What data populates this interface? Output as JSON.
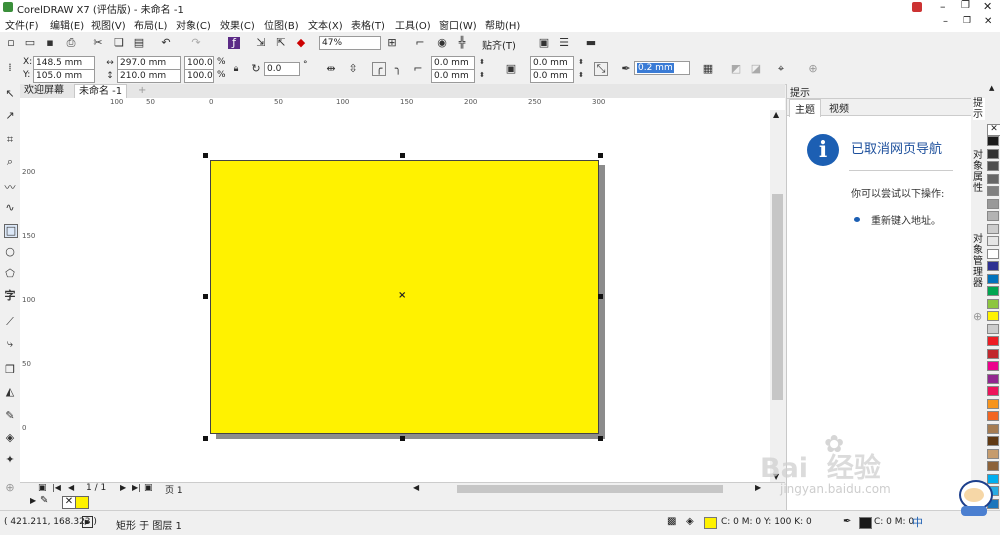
{
  "window": {
    "title": "CorelDRAW X7 (评估版) - 未命名 -1"
  },
  "menu": [
    "文件(F)",
    "编辑(E)",
    "视图(V)",
    "布局(L)",
    "对象(C)",
    "效果(C)",
    "位图(B)",
    "文本(X)",
    "表格(T)",
    "工具(O)",
    "窗口(W)",
    "帮助(H)"
  ],
  "toolbar": {
    "zoom": "47%",
    "snap": "贴齐(T)"
  },
  "propertybar": {
    "x_label": "X:",
    "x": "148.5 mm",
    "y_label": "Y:",
    "y": "105.0 mm",
    "width": "297.0 mm",
    "height": "210.0 mm",
    "scale_w": "100.0",
    "scale_h": "100.0",
    "percent": "%",
    "rotation": "0.0",
    "degree": "°",
    "corner1": "0.0 mm",
    "corner2": "0.0 mm",
    "corner3": "0.0 mm",
    "corner4": "0.0 mm",
    "outline": "0.2 mm"
  },
  "tabs": {
    "welcome": "欢迎屏幕",
    "doc": "未命名 -1",
    "add": "+"
  },
  "ruler": {
    "h_ticks": [
      "100",
      "50",
      "0",
      "50",
      "100",
      "150",
      "200",
      "250",
      "300"
    ],
    "v_ticks": [
      "200",
      "150",
      "100",
      "50",
      "0"
    ]
  },
  "page_nav": {
    "position": "1 / 1",
    "page_tab": "页 1"
  },
  "docker": {
    "title": "提示",
    "tab_topics": "主题",
    "tab_video": "视频",
    "heading": "已取消网页导航",
    "body": "你可以尝试以下操作:",
    "bullet": "重新键入地址。",
    "side_tabs": [
      "提示",
      "对象属性",
      "对象管理器"
    ]
  },
  "status": {
    "coords": "( 421.211, 168.323 )",
    "object_info": "矩形 于 图层 1",
    "fill_info": "C: 0 M: 0 Y: 100 K: 0",
    "outline_info": "C: 0 M: 0",
    "ime": "中"
  },
  "watermark": {
    "brand": "Bai  经验",
    "url": "jingyan.baidu.com"
  },
  "colors": {
    "fill": "#fff200",
    "palette": [
      "#1a1a1a",
      "#333333",
      "#4d4d4d",
      "#666666",
      "#808080",
      "#999999",
      "#b3b3b3",
      "#cccccc",
      "#e6e6e6",
      "#ffffff",
      "#2e3192",
      "#0072bc",
      "#00a651",
      "#8dc63f",
      "#fff200",
      "#cccccc",
      "#ed1c24",
      "#c1272d",
      "#ec008c",
      "#92278f",
      "#ed145b",
      "#f7941d",
      "#f26522",
      "#a67c52",
      "#603913",
      "#c69c6d",
      "#8c6239",
      "#00aeef",
      "#29abe2",
      "#1b75bc"
    ]
  }
}
